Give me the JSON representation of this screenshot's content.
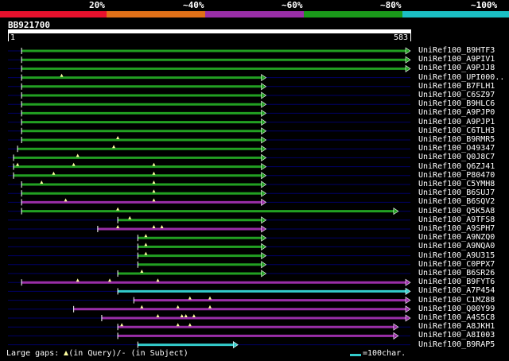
{
  "scale": {
    "percent_labels": [
      "20%",
      "~40%",
      "~60%",
      "~80%",
      "~100%"
    ],
    "bands": [
      {
        "color": "#e8112d"
      },
      {
        "color": "#e07018"
      },
      {
        "color": "#9a2ea8"
      },
      {
        "color": "#1a9a1a"
      },
      {
        "color": "#1bbfc4"
      }
    ]
  },
  "query": {
    "id": "BB921700",
    "start_label": "1",
    "end_label": "583"
  },
  "colors": {
    "green": "#22a022",
    "purple": "#9a2ea8",
    "cyan": "#33cccc",
    "navy": "#000066",
    "gap": "#ffffa0"
  },
  "hits": [
    {
      "label": "UniRef100_B9HTF3",
      "color": "green",
      "segments": [
        [
          0.03,
          1.0
        ]
      ],
      "gaps": [],
      "arrow": "right"
    },
    {
      "label": "UniRef100_A9PIV1",
      "color": "green",
      "segments": [
        [
          0.03,
          1.0
        ]
      ],
      "gaps": [],
      "arrow": "right"
    },
    {
      "label": "UniRef100_A9PJJ8",
      "color": "green",
      "segments": [
        [
          0.03,
          1.0
        ]
      ],
      "gaps": [],
      "arrow": "right"
    },
    {
      "label": "UniRef100_UPI000..",
      "color": "green",
      "segments": [
        [
          0.03,
          0.64
        ]
      ],
      "gaps": [
        0.13
      ],
      "arrow": "right"
    },
    {
      "label": "UniRef100_B7FLH1",
      "color": "green",
      "segments": [
        [
          0.03,
          0.64
        ]
      ],
      "gaps": [],
      "arrow": "right"
    },
    {
      "label": "UniRef100_C6SZ97",
      "color": "green",
      "segments": [
        [
          0.03,
          0.64
        ]
      ],
      "gaps": [],
      "arrow": "right"
    },
    {
      "label": "UniRef100_B9HLC6",
      "color": "green",
      "segments": [
        [
          0.03,
          0.64
        ]
      ],
      "gaps": [],
      "arrow": "right"
    },
    {
      "label": "UniRef100_A9PJP0",
      "color": "green",
      "segments": [
        [
          0.03,
          0.64
        ]
      ],
      "gaps": [],
      "arrow": "right"
    },
    {
      "label": "UniRef100_A9PJP1",
      "color": "green",
      "segments": [
        [
          0.03,
          0.64
        ]
      ],
      "gaps": [],
      "arrow": "right"
    },
    {
      "label": "UniRef100_C6TLH3",
      "color": "green",
      "segments": [
        [
          0.03,
          0.64
        ]
      ],
      "gaps": [],
      "arrow": "right"
    },
    {
      "label": "UniRef100_B9RMR5",
      "color": "green",
      "segments": [
        [
          0.03,
          0.64
        ]
      ],
      "gaps": [
        0.27
      ],
      "arrow": "right"
    },
    {
      "label": "UniRef100_O49347",
      "color": "green",
      "segments": [
        [
          0.02,
          0.64
        ]
      ],
      "gaps": [
        0.26
      ],
      "arrow": "right"
    },
    {
      "label": "UniRef100_Q0J8C7",
      "color": "green",
      "segments": [
        [
          0.01,
          0.64
        ]
      ],
      "gaps": [
        0.17
      ],
      "arrow": "right"
    },
    {
      "label": "UniRef100_Q6ZJ41",
      "color": "green",
      "segments": [
        [
          0.01,
          0.64
        ]
      ],
      "gaps": [
        0.02,
        0.16,
        0.36
      ],
      "arrow": "right"
    },
    {
      "label": "UniRef100_P80470",
      "color": "green",
      "segments": [
        [
          0.01,
          0.64
        ]
      ],
      "gaps": [
        0.11,
        0.36
      ],
      "arrow": "right"
    },
    {
      "label": "UniRef100_C5YMH8",
      "color": "green",
      "segments": [
        [
          0.03,
          0.64
        ]
      ],
      "gaps": [
        0.08,
        0.36
      ],
      "arrow": "right"
    },
    {
      "label": "UniRef100_B6SUJ7",
      "color": "green",
      "segments": [
        [
          0.03,
          0.64
        ]
      ],
      "gaps": [
        0.36
      ],
      "arrow": "right"
    },
    {
      "label": "UniRef100_B6SQV2",
      "color": "purple",
      "segments": [
        [
          0.03,
          0.64
        ]
      ],
      "gaps": [
        0.14,
        0.36
      ],
      "arrow": "right"
    },
    {
      "label": "UniRef100_Q5K5A8",
      "color": "green",
      "segments": [
        [
          0.03,
          0.97
        ]
      ],
      "gaps": [
        0.27
      ],
      "arrow": "right"
    },
    {
      "label": "UniRef100_A9TFS8",
      "color": "green",
      "segments": [
        [
          0.27,
          0.64
        ]
      ],
      "gaps": [
        0.3
      ],
      "arrow": "right"
    },
    {
      "label": "UniRef100_A9SPH7",
      "color": "purple",
      "segments": [
        [
          0.22,
          0.64
        ]
      ],
      "gaps": [
        0.27,
        0.36,
        0.38
      ],
      "arrow": "right"
    },
    {
      "label": "UniRef100_A9NZQ0",
      "color": "green",
      "segments": [
        [
          0.32,
          0.64
        ]
      ],
      "gaps": [
        0.34
      ],
      "arrow": "right"
    },
    {
      "label": "UniRef100_A9NQA0",
      "color": "green",
      "segments": [
        [
          0.32,
          0.64
        ]
      ],
      "gaps": [
        0.34
      ],
      "arrow": "right"
    },
    {
      "label": "UniRef100_A9U315",
      "color": "green",
      "segments": [
        [
          0.32,
          0.64
        ]
      ],
      "gaps": [
        0.34
      ],
      "arrow": "right"
    },
    {
      "label": "UniRef100_C0PPX7",
      "color": "green",
      "segments": [
        [
          0.32,
          0.64
        ]
      ],
      "gaps": [],
      "arrow": "right"
    },
    {
      "label": "UniRef100_B6SR26",
      "color": "green",
      "segments": [
        [
          0.27,
          0.64
        ]
      ],
      "gaps": [
        0.33
      ],
      "arrow": "right"
    },
    {
      "label": "UniRef100_B9FYT6",
      "color": "purple",
      "segments": [
        [
          0.03,
          1.0
        ]
      ],
      "gaps": [
        0.17,
        0.25,
        0.37
      ],
      "arrow": "right"
    },
    {
      "label": "UniRef100_A7P454",
      "color": "cyan",
      "segments": [
        [
          0.27,
          1.0
        ]
      ],
      "gaps": [],
      "arrow": "right"
    },
    {
      "label": "UniRef100_C1MZ88",
      "color": "purple",
      "segments": [
        [
          0.31,
          1.0
        ]
      ],
      "gaps": [
        0.45,
        0.5
      ],
      "arrow": "right"
    },
    {
      "label": "UniRef100_Q00Y99",
      "color": "purple",
      "segments": [
        [
          0.16,
          1.0
        ]
      ],
      "gaps": [
        0.33,
        0.42,
        0.5
      ],
      "arrow": "right"
    },
    {
      "label": "UniRef100_A4S5C8",
      "color": "purple",
      "segments": [
        [
          0.23,
          1.0
        ]
      ],
      "gaps": [
        0.37,
        0.43,
        0.44,
        0.46
      ],
      "arrow": "right"
    },
    {
      "label": "UniRef100_A8JKH1",
      "color": "purple",
      "segments": [
        [
          0.27,
          0.97
        ]
      ],
      "gaps": [
        0.28,
        0.42,
        0.45
      ],
      "arrow": "right"
    },
    {
      "label": "UniRef100_A8I003",
      "color": "purple",
      "segments": [
        [
          0.27,
          0.97
        ]
      ],
      "gaps": [],
      "arrow": "right"
    },
    {
      "label": "UniRef100_B9RAP5",
      "color": "cyan",
      "segments": [
        [
          0.32,
          0.57
        ]
      ],
      "gaps": [],
      "arrow": "right"
    }
  ],
  "footer": {
    "large_gaps_prefix": "Large gaps:",
    "in_query": "(in Query)/",
    "in_subject": "- (in Subject)",
    "legend": "=100char."
  }
}
